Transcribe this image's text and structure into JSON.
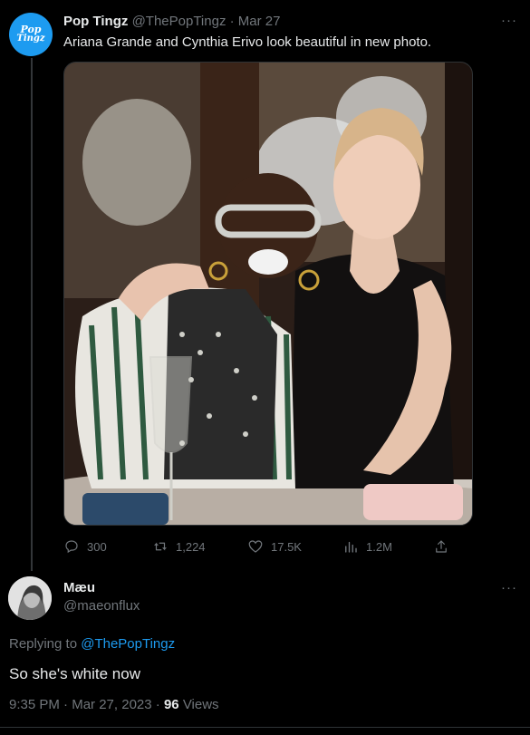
{
  "tweet": {
    "author_name": "Pop Tingz",
    "handle": "@ThePopTingz",
    "separator": "·",
    "date": "Mar 27",
    "text": "Ariana Grande and Cynthia Erivo look beautiful in new photo.",
    "avatar_logo_top": "Pop",
    "avatar_logo_bottom": "Tingz",
    "more_label": "···",
    "stats": {
      "replies": "300",
      "retweets": "1,224",
      "likes": "17.5K",
      "views": "1.2M"
    }
  },
  "reply": {
    "author_name": "Mæu",
    "handle": "@maeonflux",
    "more_label": "···",
    "replying_prefix": "Replying to",
    "replying_to": "@ThePopTingz",
    "text": "So she's white now",
    "time": "9:35 PM",
    "separator": "·",
    "date": "Mar 27, 2023",
    "separator2": "·",
    "views_count": "96",
    "views_label": "Views"
  },
  "icons": {
    "reply": "reply-icon",
    "retweet": "retweet-icon",
    "like": "heart-icon",
    "views": "analytics-icon",
    "share": "share-icon"
  },
  "colors": {
    "background": "#000000",
    "accent": "#1d9bf0",
    "muted": "#71767b",
    "text": "#e7e9ea"
  }
}
